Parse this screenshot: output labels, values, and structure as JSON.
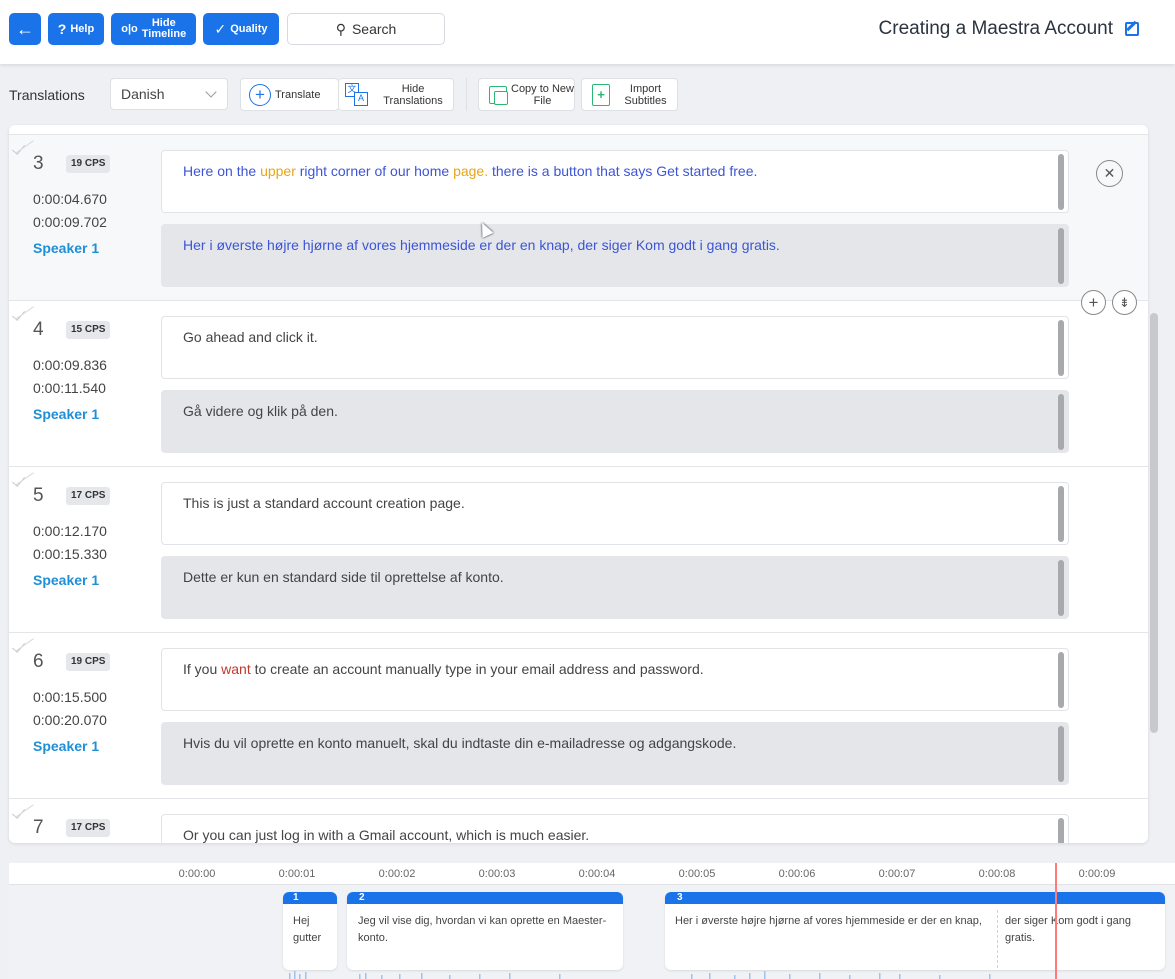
{
  "topbar": {
    "back_icon": "←",
    "help_icon": "?",
    "help_label": "Help",
    "hide_timeline_icon": "o|o",
    "hide_timeline_label": "Hide Timeline",
    "quality_icon": "✓",
    "quality_label": "Quality",
    "search_icon": "⚲",
    "search_label": "Search",
    "title": "Creating a Maestra Account"
  },
  "toolbar": {
    "translations_label": "Translations",
    "language": "Danish",
    "translate_label": "Translate",
    "hide_translations_label": "Hide Translations",
    "copy_label": "Copy to New File",
    "import_label": "Import Subtitles",
    "import_icon": "+"
  },
  "rows": [
    {
      "num": "3",
      "cps": "19 CPS",
      "start": "0:00:04.670",
      "end": "0:00:09.702",
      "speaker": "Speaker 1",
      "orig_parts": [
        "Here on the ",
        "upper",
        " right corner of our home ",
        "page.",
        " there is a button that says Get started free."
      ],
      "trans": "Her i øverste højre hjørne af vores hjemmeside er der en knap, der siger Kom godt i gang gratis."
    },
    {
      "num": "4",
      "cps": "15 CPS",
      "start": "0:00:09.836",
      "end": "0:00:11.540",
      "speaker": "Speaker 1",
      "orig": "Go ahead and click it.",
      "trans": "Gå videre og klik på den."
    },
    {
      "num": "5",
      "cps": "17 CPS",
      "start": "0:00:12.170",
      "end": "0:00:15.330",
      "speaker": "Speaker 1",
      "orig": "This is just a standard account creation page.",
      "trans": "Dette er kun en standard side til oprettelse af konto."
    },
    {
      "num": "6",
      "cps": "19 CPS",
      "start": "0:00:15.500",
      "end": "0:00:20.070",
      "speaker": "Speaker 1",
      "orig_parts": [
        "If you ",
        "want",
        " to create an account manually type in your email address and password."
      ],
      "trans": "Hvis du vil oprette en konto manuelt, skal du indtaste din e-mailadresse og adgangskode."
    },
    {
      "num": "7",
      "cps": "17 CPS",
      "orig": "Or you can just log in with a Gmail account, which is much easier."
    }
  ],
  "row_controls": {
    "close_icon": "✕",
    "add_icon": "+",
    "merge_icon": "⇟"
  },
  "timeline": {
    "ticks": [
      "0:00:00",
      "0:00:01",
      "0:00:02",
      "0:00:03",
      "0:00:04",
      "0:00:05",
      "0:00:06",
      "0:00:07",
      "0:00:08",
      "0:00:09"
    ],
    "segments": [
      {
        "num": "1",
        "text": "Hej gutter"
      },
      {
        "num": "2",
        "text": "Jeg vil vise dig, hvordan vi kan oprette en Maester-konto."
      },
      {
        "num": "3",
        "text_a": "Her i øverste højre hjørne af vores hjemmeside er der en knap,",
        "text_b": "der siger Kom godt i gang gratis."
      }
    ]
  },
  "colors": {
    "accent": "#1a73e8",
    "speaker": "#1f8fd6",
    "highlight_yellow": "#e8a517",
    "highlight_red": "#c0392b"
  }
}
